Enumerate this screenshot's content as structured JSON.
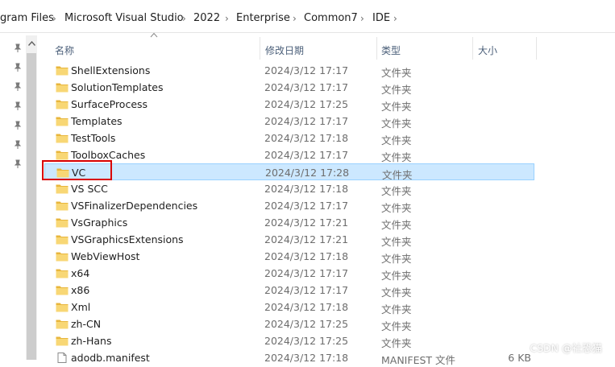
{
  "breadcrumb": {
    "items": [
      "gram Files",
      "Microsoft Visual Studio",
      "2022",
      "Enterprise",
      "Common7",
      "IDE"
    ],
    "separator": ">"
  },
  "columns": {
    "name": "名称",
    "date": "修改日期",
    "type": "类型",
    "size": "大小"
  },
  "files": [
    {
      "name": "ShellExtensions",
      "date": "2024/3/12 17:17",
      "type": "文件夹",
      "size": "",
      "icon": "folder-icon"
    },
    {
      "name": "SolutionTemplates",
      "date": "2024/3/12 17:17",
      "type": "文件夹",
      "size": "",
      "icon": "folder-icon"
    },
    {
      "name": "SurfaceProcess",
      "date": "2024/3/12 17:25",
      "type": "文件夹",
      "size": "",
      "icon": "folder-icon"
    },
    {
      "name": "Templates",
      "date": "2024/3/12 17:17",
      "type": "文件夹",
      "size": "",
      "icon": "folder-icon"
    },
    {
      "name": "TestTools",
      "date": "2024/3/12 17:18",
      "type": "文件夹",
      "size": "",
      "icon": "folder-icon"
    },
    {
      "name": "ToolboxCaches",
      "date": "2024/3/12 17:17",
      "type": "文件夹",
      "size": "",
      "icon": "folder-icon"
    },
    {
      "name": "VC",
      "date": "2024/3/12 17:28",
      "type": "文件夹",
      "size": "",
      "icon": "folder-icon",
      "selected": true
    },
    {
      "name": "VS SCC",
      "date": "2024/3/12 17:18",
      "type": "文件夹",
      "size": "",
      "icon": "folder-icon"
    },
    {
      "name": "VSFinalizerDependencies",
      "date": "2024/3/12 17:17",
      "type": "文件夹",
      "size": "",
      "icon": "folder-icon"
    },
    {
      "name": "VsGraphics",
      "date": "2024/3/12 17:21",
      "type": "文件夹",
      "size": "",
      "icon": "folder-icon"
    },
    {
      "name": "VSGraphicsExtensions",
      "date": "2024/3/12 17:21",
      "type": "文件夹",
      "size": "",
      "icon": "folder-icon"
    },
    {
      "name": "WebViewHost",
      "date": "2024/3/12 17:18",
      "type": "文件夹",
      "size": "",
      "icon": "folder-icon"
    },
    {
      "name": "x64",
      "date": "2024/3/12 17:17",
      "type": "文件夹",
      "size": "",
      "icon": "folder-icon"
    },
    {
      "name": "x86",
      "date": "2024/3/12 17:17",
      "type": "文件夹",
      "size": "",
      "icon": "folder-icon"
    },
    {
      "name": "Xml",
      "date": "2024/3/12 17:18",
      "type": "文件夹",
      "size": "",
      "icon": "folder-icon"
    },
    {
      "name": "zh-CN",
      "date": "2024/3/12 17:25",
      "type": "文件夹",
      "size": "",
      "icon": "folder-icon"
    },
    {
      "name": "zh-Hans",
      "date": "2024/3/12 17:25",
      "type": "文件夹",
      "size": "",
      "icon": "folder-icon"
    },
    {
      "name": "adodb.manifest",
      "date": "2024/3/12 17:18",
      "type": "MANIFEST 文件",
      "size": "6 KB",
      "icon": "file-icon"
    }
  ],
  "watermark": "CSDN @社恐猫",
  "colors": {
    "folder": "#f8d775",
    "folder_dark": "#e8b63c",
    "selection": "#cce8ff",
    "highlight": "#d90000"
  }
}
